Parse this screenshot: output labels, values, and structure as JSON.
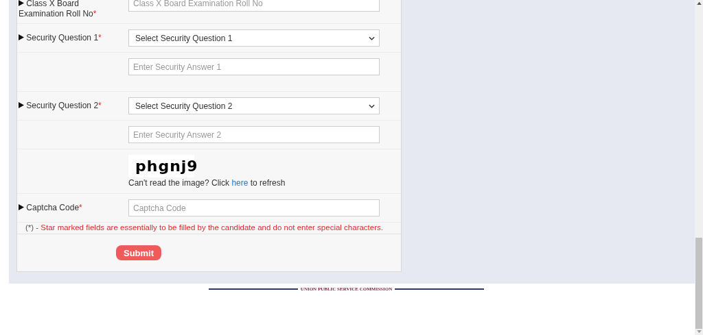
{
  "form": {
    "rows": [
      {
        "kind": "input",
        "label": "Class X Board Examination Roll No",
        "mark": "*",
        "placeholder": "Class X Board Examination Roll No"
      },
      {
        "kind": "select",
        "label": "Security Question 1",
        "mark": "*",
        "value": "Select Security Question 1"
      },
      {
        "kind": "input",
        "placeholder": "Enter Security Answer 1"
      },
      {
        "kind": "select",
        "label": "Security Question 2",
        "mark": "*",
        "value": "Select Security Question 2"
      },
      {
        "kind": "input",
        "placeholder": "Enter Security Answer 2"
      },
      {
        "kind": "captcha",
        "captcha_text": "phgnj9",
        "hint_before": "Can't read the image? Click",
        "link": "here",
        "hint_after": "to refresh"
      },
      {
        "kind": "input",
        "label": "Captcha Code",
        "mark": "*",
        "placeholder": "Captcha Code"
      }
    ],
    "note": {
      "prefix": "(*) -",
      "text": "Star marked fields are essentially to be filled by the candidate and do not enter special characters."
    },
    "submit": "Submit"
  },
  "footer": {
    "text": "UNION PUBLIC SERVICE COMMISSION"
  }
}
